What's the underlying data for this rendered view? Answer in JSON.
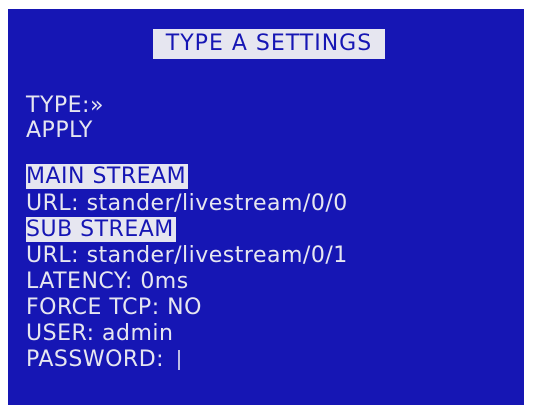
{
  "header": {
    "title": "TYPE A SETTINGS"
  },
  "menu": {
    "type_label": "TYPE:",
    "type_value": "»",
    "apply_label": "APPLY"
  },
  "main_stream": {
    "heading": "MAIN STREAM",
    "url_label": "URL:",
    "url_value": "stander/livestream/0/0"
  },
  "sub_stream": {
    "heading": "SUB STREAM",
    "url_label": "URL:",
    "url_value": "stander/livestream/0/1"
  },
  "settings": {
    "latency_label": "LATENCY:",
    "latency_value": "0ms",
    "force_tcp_label": "FORCE TCP:",
    "force_tcp_value": "NO",
    "user_label": "USER:",
    "user_value": "admin",
    "password_label": "PASSWORD:",
    "password_value": ""
  },
  "colors": {
    "background": "#1616b4",
    "text": "#e6e6f0",
    "highlight_bg": "#e6e6f0",
    "highlight_text": "#1616b4"
  }
}
